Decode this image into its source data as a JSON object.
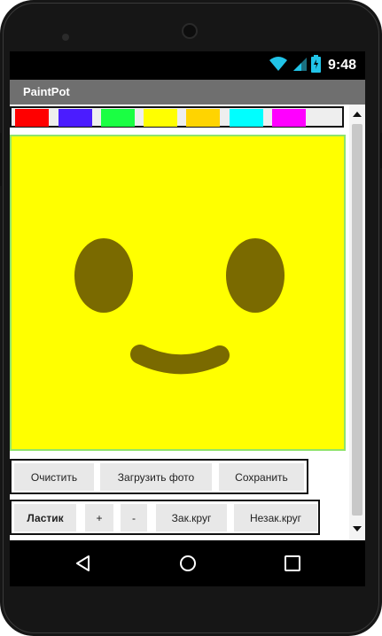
{
  "app": {
    "title": "PaintPot"
  },
  "status_bar": {
    "time": "9:48",
    "icons": [
      "wifi-icon",
      "cell-signal-icon",
      "battery-icon"
    ]
  },
  "palette": {
    "colors": [
      "#ff0000",
      "#4b1cff",
      "#1aff43",
      "#ffff00",
      "#ffd400",
      "#00ffff",
      "#ff00ff"
    ]
  },
  "canvas": {
    "background": "#ffff00",
    "drawing_color": "#7a6a00"
  },
  "row1": {
    "clear_label": "Очистить",
    "load_photo_label": "Загрузить фото",
    "save_label": "Сохранить"
  },
  "row2": {
    "eraser_label": "Ластик",
    "plus_label": "+",
    "minus_label": "-",
    "filled_circle_label": "Зак.круг",
    "empty_circle_label": "Незак.круг"
  },
  "nav": {
    "icons": [
      "back-icon",
      "home-icon",
      "recents-icon"
    ]
  }
}
